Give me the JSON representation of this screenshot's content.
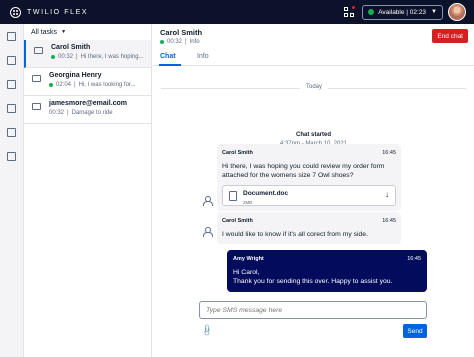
{
  "app": {
    "brand": "TWILIO FLEX"
  },
  "topbar": {
    "status": "Available | 02:23",
    "status_color": "#14b053"
  },
  "sidebar": {
    "icons": [
      "tasks-icon",
      "layers-icon",
      "list-icon",
      "calculator-icon",
      "grid-icon",
      "chart-icon"
    ]
  },
  "tasks": {
    "filter_label": "All tasks",
    "items": [
      {
        "name": "Carol Smith",
        "time": "00:32",
        "preview": "Hi there, I was hoping...",
        "channel": "chat"
      },
      {
        "name": "Georgina Henry",
        "time": "02:04",
        "preview": "Hi, I was looking for...",
        "channel": "chat"
      },
      {
        "name": "jamesmore@email.com",
        "time": "00:32",
        "preview": "Damage to ride",
        "channel": "email"
      }
    ]
  },
  "chat": {
    "name": "Carol Smith",
    "time": "00:32",
    "info": "Info",
    "end_label": "End chat",
    "tabs": [
      "Chat",
      "Info"
    ],
    "day": "Today",
    "system_title": "Chat started",
    "system_time": "4:37pm - March 10, 2021",
    "messages": [
      {
        "author": "Carol Smith",
        "time": "16:45",
        "text": "Hi there, I was hoping you could review my order form attached for the womens size 7 Owl shoes?",
        "attachment": {
          "name": "Document.doc",
          "size": "2MB"
        }
      },
      {
        "author": "Carol Smith",
        "time": "16:45",
        "text": "I would like to know if it's all corect from my side."
      },
      {
        "author": "Amy Wright",
        "time": "16:45",
        "line1": "Hi Carol,",
        "line2": "Thank you for sending this over. Happy to assist you."
      }
    ],
    "composer_placeholder": "Type SMS message here",
    "send_label": "Send"
  }
}
